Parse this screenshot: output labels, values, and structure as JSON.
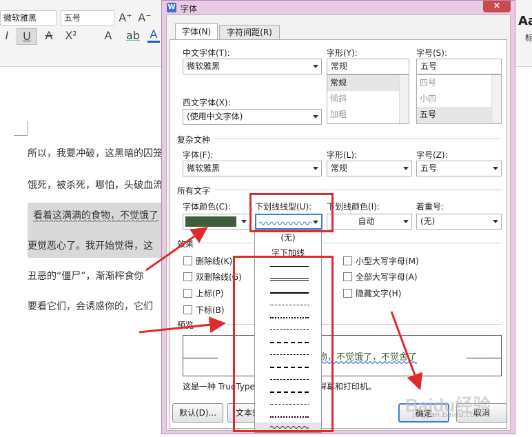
{
  "ribbon": {
    "font_name": "微软雅黑",
    "font_size": "五号",
    "grow_font": "A⁺",
    "shrink_font": "A⁻",
    "italic": "I",
    "underline": "U",
    "strike": "A",
    "superscript": "X²",
    "text_effect": "A",
    "highlight": "ab",
    "font_color": "A",
    "styles_preview": "Aa",
    "styles_label": "标"
  },
  "document": {
    "lines": [
      "所以，我要冲破，这黑暗的囚笼",
      "饿死，被杀死，哪怕，头破血流",
      "看着这满满的食物，不觉饿了",
      "更觉恶心了。我开始觉得，这",
      "丑恶的“僵尸”，渐渐榨食你",
      "要看它们，会诱惑你的，它们"
    ]
  },
  "dialog": {
    "title": "字体",
    "close": "×",
    "tabs": [
      "字体(N)",
      "字符间距(R)"
    ],
    "chinese_font_label": "中文字体(T):",
    "chinese_font_value": "微软雅黑",
    "style_label": "字形(Y):",
    "style_value": "常规",
    "style_list": [
      "常规",
      "倾斜",
      "加粗"
    ],
    "size_label": "字号(S):",
    "size_value": "五号",
    "size_list": [
      "四号",
      "小四",
      "五号"
    ],
    "western_font_label": "西文字体(X):",
    "western_font_value": "(使用中文字体)",
    "complex_section": "复杂文种",
    "complex_font_label": "字体(F):",
    "complex_font_value": "微软雅黑",
    "complex_style_label": "字形(L):",
    "complex_style_value": "常规",
    "complex_size_label": "字号(Z):",
    "complex_size_value": "五号",
    "all_text_section": "所有文字",
    "font_color_label": "字体颜色(C):",
    "font_color": "#3f5d3d",
    "underline_type_label": "下划线线型(U):",
    "underline_color_label": "下划线颜色(I):",
    "underline_color_value": "自动",
    "emphasis_label": "着重号:",
    "emphasis_value": "(无)",
    "effects_section": "效果",
    "effects_left": [
      "删除线(K)",
      "双删除线(G)",
      "上标(P)",
      "下标(B)"
    ],
    "effects_right": [
      "小型大写字母(M)",
      "全部大写字母(A)",
      "隐藏文字(H)"
    ],
    "preview_section": "预览",
    "preview_text": "物，不觉饿了，不觉舍了",
    "note": "这是一种 TrueType",
    "note_tail": "屏幕和打印机。",
    "default_button": "默认(D)...",
    "text_effect_button": "文本效",
    "ok_button": "确定",
    "cancel_button": "取消",
    "underline_options": [
      "(无)",
      "字下加线"
    ]
  },
  "colors": {
    "accent": "#e02a2a",
    "dialog_frame": "#e9c9e6",
    "selected_blue": "#3d7fd6"
  },
  "watermark": "Baidu经验",
  "watermark_url": "jingyan.baidu.com"
}
